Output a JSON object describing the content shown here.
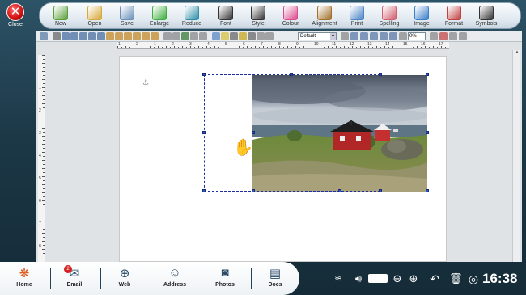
{
  "close": {
    "label": "Close"
  },
  "toolbar": [
    {
      "id": "new",
      "label": "New",
      "icon": "new-document-icon",
      "color": "#5a9e3a"
    },
    {
      "id": "open",
      "label": "Open",
      "icon": "folder-open-icon",
      "color": "#d7a83a"
    },
    {
      "id": "save",
      "label": "Save",
      "icon": "save-icon",
      "color": "#6a8fb8"
    },
    {
      "id": "enlarge",
      "label": "Enlarge",
      "icon": "plus-circle-icon",
      "color": "#3fae3f"
    },
    {
      "id": "reduce",
      "label": "Reduce",
      "icon": "minus-circle-icon",
      "color": "#2f8fa8"
    },
    {
      "id": "font",
      "label": "Font",
      "icon": "font-t-icon",
      "color": "#333333"
    },
    {
      "id": "style",
      "label": "Style",
      "icon": "italic-t-icon",
      "color": "#333333"
    },
    {
      "id": "colour",
      "label": "Colour",
      "icon": "colour-wheel-icon",
      "color": "#d94a8c"
    },
    {
      "id": "alignment",
      "label": "Alignment",
      "icon": "ruler-triangle-icon",
      "color": "#a0702a"
    },
    {
      "id": "print",
      "label": "Print",
      "icon": "printer-icon",
      "color": "#4a84c4"
    },
    {
      "id": "spelling",
      "label": "Spelling",
      "icon": "eraser-icon",
      "color": "#d06070"
    },
    {
      "id": "image",
      "label": "Image",
      "icon": "image-icon",
      "color": "#3a7fc8"
    },
    {
      "id": "format",
      "label": "Format",
      "icon": "format-page-icon",
      "color": "#c04040"
    },
    {
      "id": "symbols",
      "label": "Symbols",
      "icon": "symbols-icon",
      "color": "#333333"
    }
  ],
  "format_bar": {
    "paragraph_style": "Default",
    "zoom": "0%"
  },
  "ruler": {
    "h_numbers": [
      "1",
      "2",
      "1",
      "2",
      "3",
      "4",
      "5",
      "6",
      "7",
      "8",
      "9",
      "10",
      "11",
      "12",
      "13",
      "14",
      "15",
      "16",
      "17"
    ],
    "v_numbers": [
      "1",
      "2",
      "3",
      "4",
      "5",
      "6",
      "7",
      "8"
    ]
  },
  "bottom_nav": [
    {
      "id": "home",
      "label": "Home",
      "icon": "home-logo-icon"
    },
    {
      "id": "email",
      "label": "Email",
      "icon": "envelope-icon"
    },
    {
      "id": "web",
      "label": "Web",
      "icon": "globe-icon"
    },
    {
      "id": "address",
      "label": "Address",
      "icon": "address-book-icon"
    },
    {
      "id": "photos",
      "label": "Photos",
      "icon": "camera-icon"
    },
    {
      "id": "docs",
      "label": "Docs",
      "icon": "documents-icon"
    }
  ],
  "email_badge": "2",
  "status": {
    "clock": "16:38"
  },
  "colors": {
    "background": "#1b3645",
    "selection_frame": "#1f2f9e",
    "close_red": "#d10f0f"
  }
}
